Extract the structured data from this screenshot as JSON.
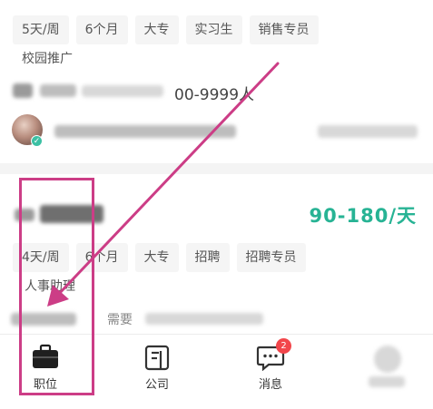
{
  "job_card_1": {
    "tags_row_1": [
      "5天/周",
      "6个月",
      "大专",
      "实习生",
      "销售专员"
    ],
    "tags_row_2": [
      "校园推广"
    ],
    "company_size": "00-9999人"
  },
  "job_card_2": {
    "salary": "90-180/天",
    "tags_row_1": [
      "4天/周",
      "6个月",
      "大专",
      "招聘",
      "招聘专员"
    ],
    "tags_row_2_text": "人事助理",
    "tags_row_3_fragment": "需要"
  },
  "tab_bar": {
    "tabs": [
      {
        "label": "职位",
        "icon": "briefcase-icon"
      },
      {
        "label": "公司",
        "icon": "company-icon"
      },
      {
        "label": "消息",
        "icon": "message-icon",
        "badge": "2"
      },
      {
        "label": "",
        "icon": "profile-icon"
      }
    ]
  },
  "colors": {
    "salary": "#27b394",
    "badge": "#f2464b",
    "annotation": "#cc3d86"
  }
}
